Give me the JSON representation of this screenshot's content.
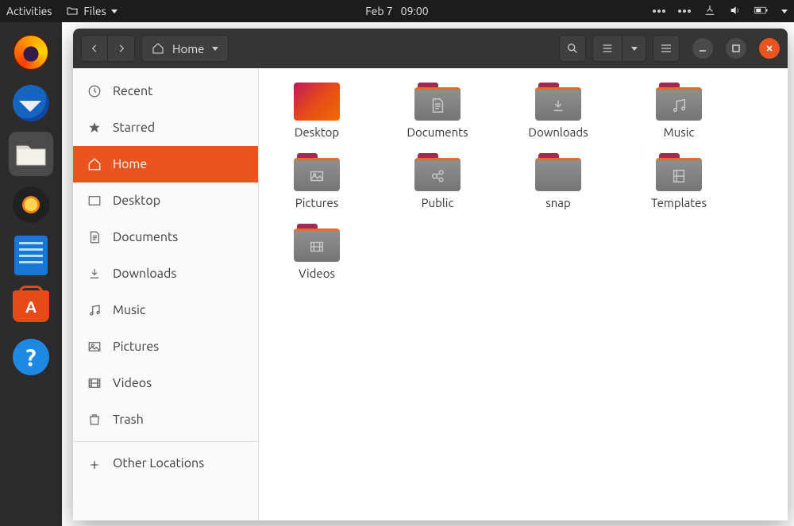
{
  "panel": {
    "activities": "Activities",
    "files_label": "Files",
    "date": "Feb 7",
    "time": "09:00"
  },
  "dock": {
    "items": [
      "Firefox",
      "Thunderbird",
      "Files",
      "Rhythmbox",
      "LibreOffice Writer",
      "Ubuntu Software",
      "Help"
    ]
  },
  "window": {
    "path": "Home"
  },
  "sidebar": {
    "items": [
      {
        "label": "Recent"
      },
      {
        "label": "Starred"
      },
      {
        "label": "Home"
      },
      {
        "label": "Desktop"
      },
      {
        "label": "Documents"
      },
      {
        "label": "Downloads"
      },
      {
        "label": "Music"
      },
      {
        "label": "Pictures"
      },
      {
        "label": "Videos"
      },
      {
        "label": "Trash"
      }
    ],
    "other": "Other Locations"
  },
  "files": [
    {
      "name": "Desktop",
      "kind": "desktop"
    },
    {
      "name": "Documents",
      "kind": "documents"
    },
    {
      "name": "Downloads",
      "kind": "downloads"
    },
    {
      "name": "Music",
      "kind": "music"
    },
    {
      "name": "Pictures",
      "kind": "pictures"
    },
    {
      "name": "Public",
      "kind": "public"
    },
    {
      "name": "snap",
      "kind": "plain"
    },
    {
      "name": "Templates",
      "kind": "templates"
    },
    {
      "name": "Videos",
      "kind": "videos"
    }
  ]
}
